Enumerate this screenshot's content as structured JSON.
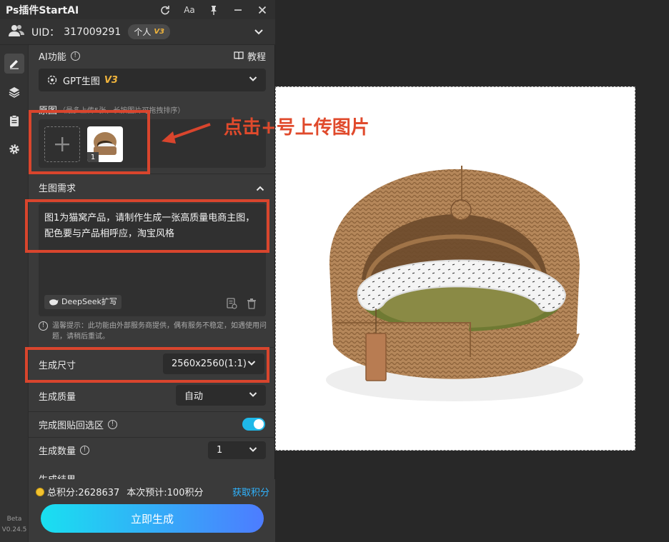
{
  "app": {
    "title": "Ps插件StartAI"
  },
  "titlebar": {
    "font_btn": "Aa"
  },
  "user": {
    "uid_label": "UID：",
    "uid_value": "317009291",
    "plan": "个人",
    "plan_version": "V3"
  },
  "ai_feature": {
    "label": "AI功能",
    "tutorial": "教程",
    "model": "GPT生图",
    "model_version": "V3"
  },
  "reference": {
    "label": "原图",
    "hint": "（最多上传5张，长按图片可拖拽排序）",
    "thumb_index": "1"
  },
  "prompt": {
    "section_label": "生图需求",
    "text": "图1为猫窝产品，请制作生成一张高质量电商主图，配色要与产品相呼应，淘宝风格",
    "expand_btn": "DeepSeek扩写",
    "tip": "温馨提示：此功能由外部服务商提供，偶有服务不稳定，如遇使用问题，请稍后重试。"
  },
  "options": {
    "size_label": "生成尺寸",
    "size_value": "2560x2560(1:1)",
    "quality_label": "生成质量",
    "quality_value": "自动",
    "paste_label": "完成图贴回选区",
    "paste_enabled": true,
    "count_label": "生成数量",
    "count_value": "1",
    "result_label": "生成结果"
  },
  "footer": {
    "total_points": "总积分:2628637",
    "estimate": "本次预计:100积分",
    "get_points": "获取积分",
    "generate": "立即生成"
  },
  "version": {
    "beta": "Beta",
    "number": "V0.24.5"
  },
  "annotation": {
    "text": "点击+号上传图片"
  },
  "colors": {
    "accent": "#1fb8e8",
    "highlight": "#d9452d",
    "link": "#2fb4ff",
    "badge_version": "#f0b43c"
  }
}
